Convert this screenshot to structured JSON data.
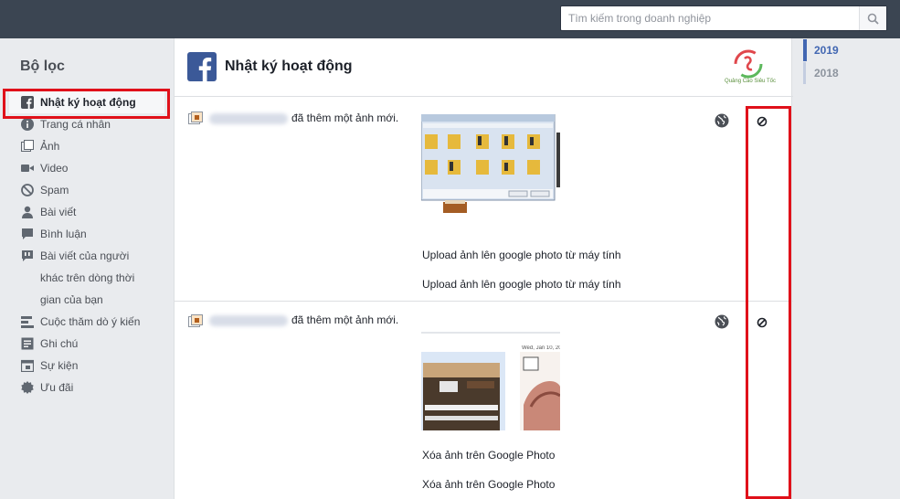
{
  "search": {
    "placeholder": "Tìm kiếm trong doanh nghiệp",
    "icon": "search-icon"
  },
  "sidebar": {
    "title": "Bộ lọc",
    "items": [
      {
        "label": "Nhật ký hoạt động",
        "icon": "facebook-icon",
        "active": true
      },
      {
        "label": "Trang cá nhân",
        "icon": "info-icon"
      },
      {
        "label": "Ảnh",
        "icon": "photo-icon"
      },
      {
        "label": "Video",
        "icon": "video-icon"
      },
      {
        "label": "Spam",
        "icon": "spam-icon"
      },
      {
        "label": "Bài viết",
        "icon": "person-icon"
      },
      {
        "label": "Bình luận",
        "icon": "comment-icon"
      },
      {
        "label": "Bài viết của người",
        "icon": "post-icon"
      },
      {
        "label": "khác trên dòng thời"
      },
      {
        "label": "gian của bạn"
      },
      {
        "label": "Cuộc thăm dò ý kiến",
        "icon": "poll-icon"
      },
      {
        "label": "Ghi chú",
        "icon": "note-icon"
      },
      {
        "label": "Sự kiện",
        "icon": "calendar-icon"
      },
      {
        "label": "Ưu đãi",
        "icon": "offer-icon"
      }
    ]
  },
  "main": {
    "title": "Nhật ký hoạt động",
    "brand": "Quảng Cáo Siêu Tốc",
    "entries": [
      {
        "action": "đã thêm một ảnh mới.",
        "caption1": "Upload ảnh lên google photo từ máy tính",
        "caption2": "Upload ảnh lên google photo từ máy tính"
      },
      {
        "action": "đã thêm một ảnh mới.",
        "date_label": "Wed, Jan 10, 201",
        "caption1": "Xóa ảnh trên Google Photo",
        "caption2": "Xóa ảnh trên Google Photo"
      }
    ]
  },
  "years": [
    "2019",
    "2018"
  ],
  "colors": {
    "accent": "#4267b2",
    "highlight": "#e0111a",
    "topbar": "#3b4552"
  }
}
